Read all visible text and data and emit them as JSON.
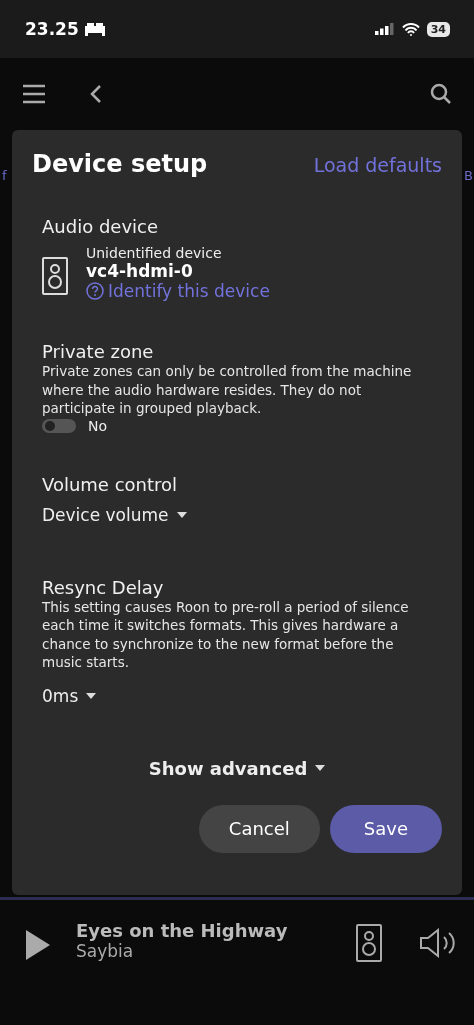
{
  "status_bar": {
    "time": "23.25",
    "battery": "34"
  },
  "background": {
    "left_fragment": "f",
    "right_fragment": "B"
  },
  "dialog": {
    "title": "Device setup",
    "load_defaults": "Load defaults",
    "audio_device": {
      "heading": "Audio device",
      "subtitle": "Unidentified device",
      "name": "vc4-hdmi-0",
      "identify_link": "Identify this device"
    },
    "private_zone": {
      "heading": "Private zone",
      "description": "Private zones can only be controlled from the machine where the audio hardware resides. They do not participate in grouped playback.",
      "on": false,
      "value_label": "No"
    },
    "volume_control": {
      "heading": "Volume control",
      "value": "Device volume"
    },
    "resync_delay": {
      "heading": "Resync Delay",
      "description": "This setting causes Roon to pre-roll a period of silence each time it switches formats. This gives hardware a chance to synchronize to the new format before the music starts.",
      "value": "0ms"
    },
    "show_advanced": "Show advanced",
    "buttons": [
      {
        "label": "Cancel",
        "kind": "secondary"
      },
      {
        "label": "Save",
        "kind": "primary"
      }
    ]
  },
  "now_playing": {
    "title": "Eyes on the Highway",
    "artist": "Saybia"
  }
}
